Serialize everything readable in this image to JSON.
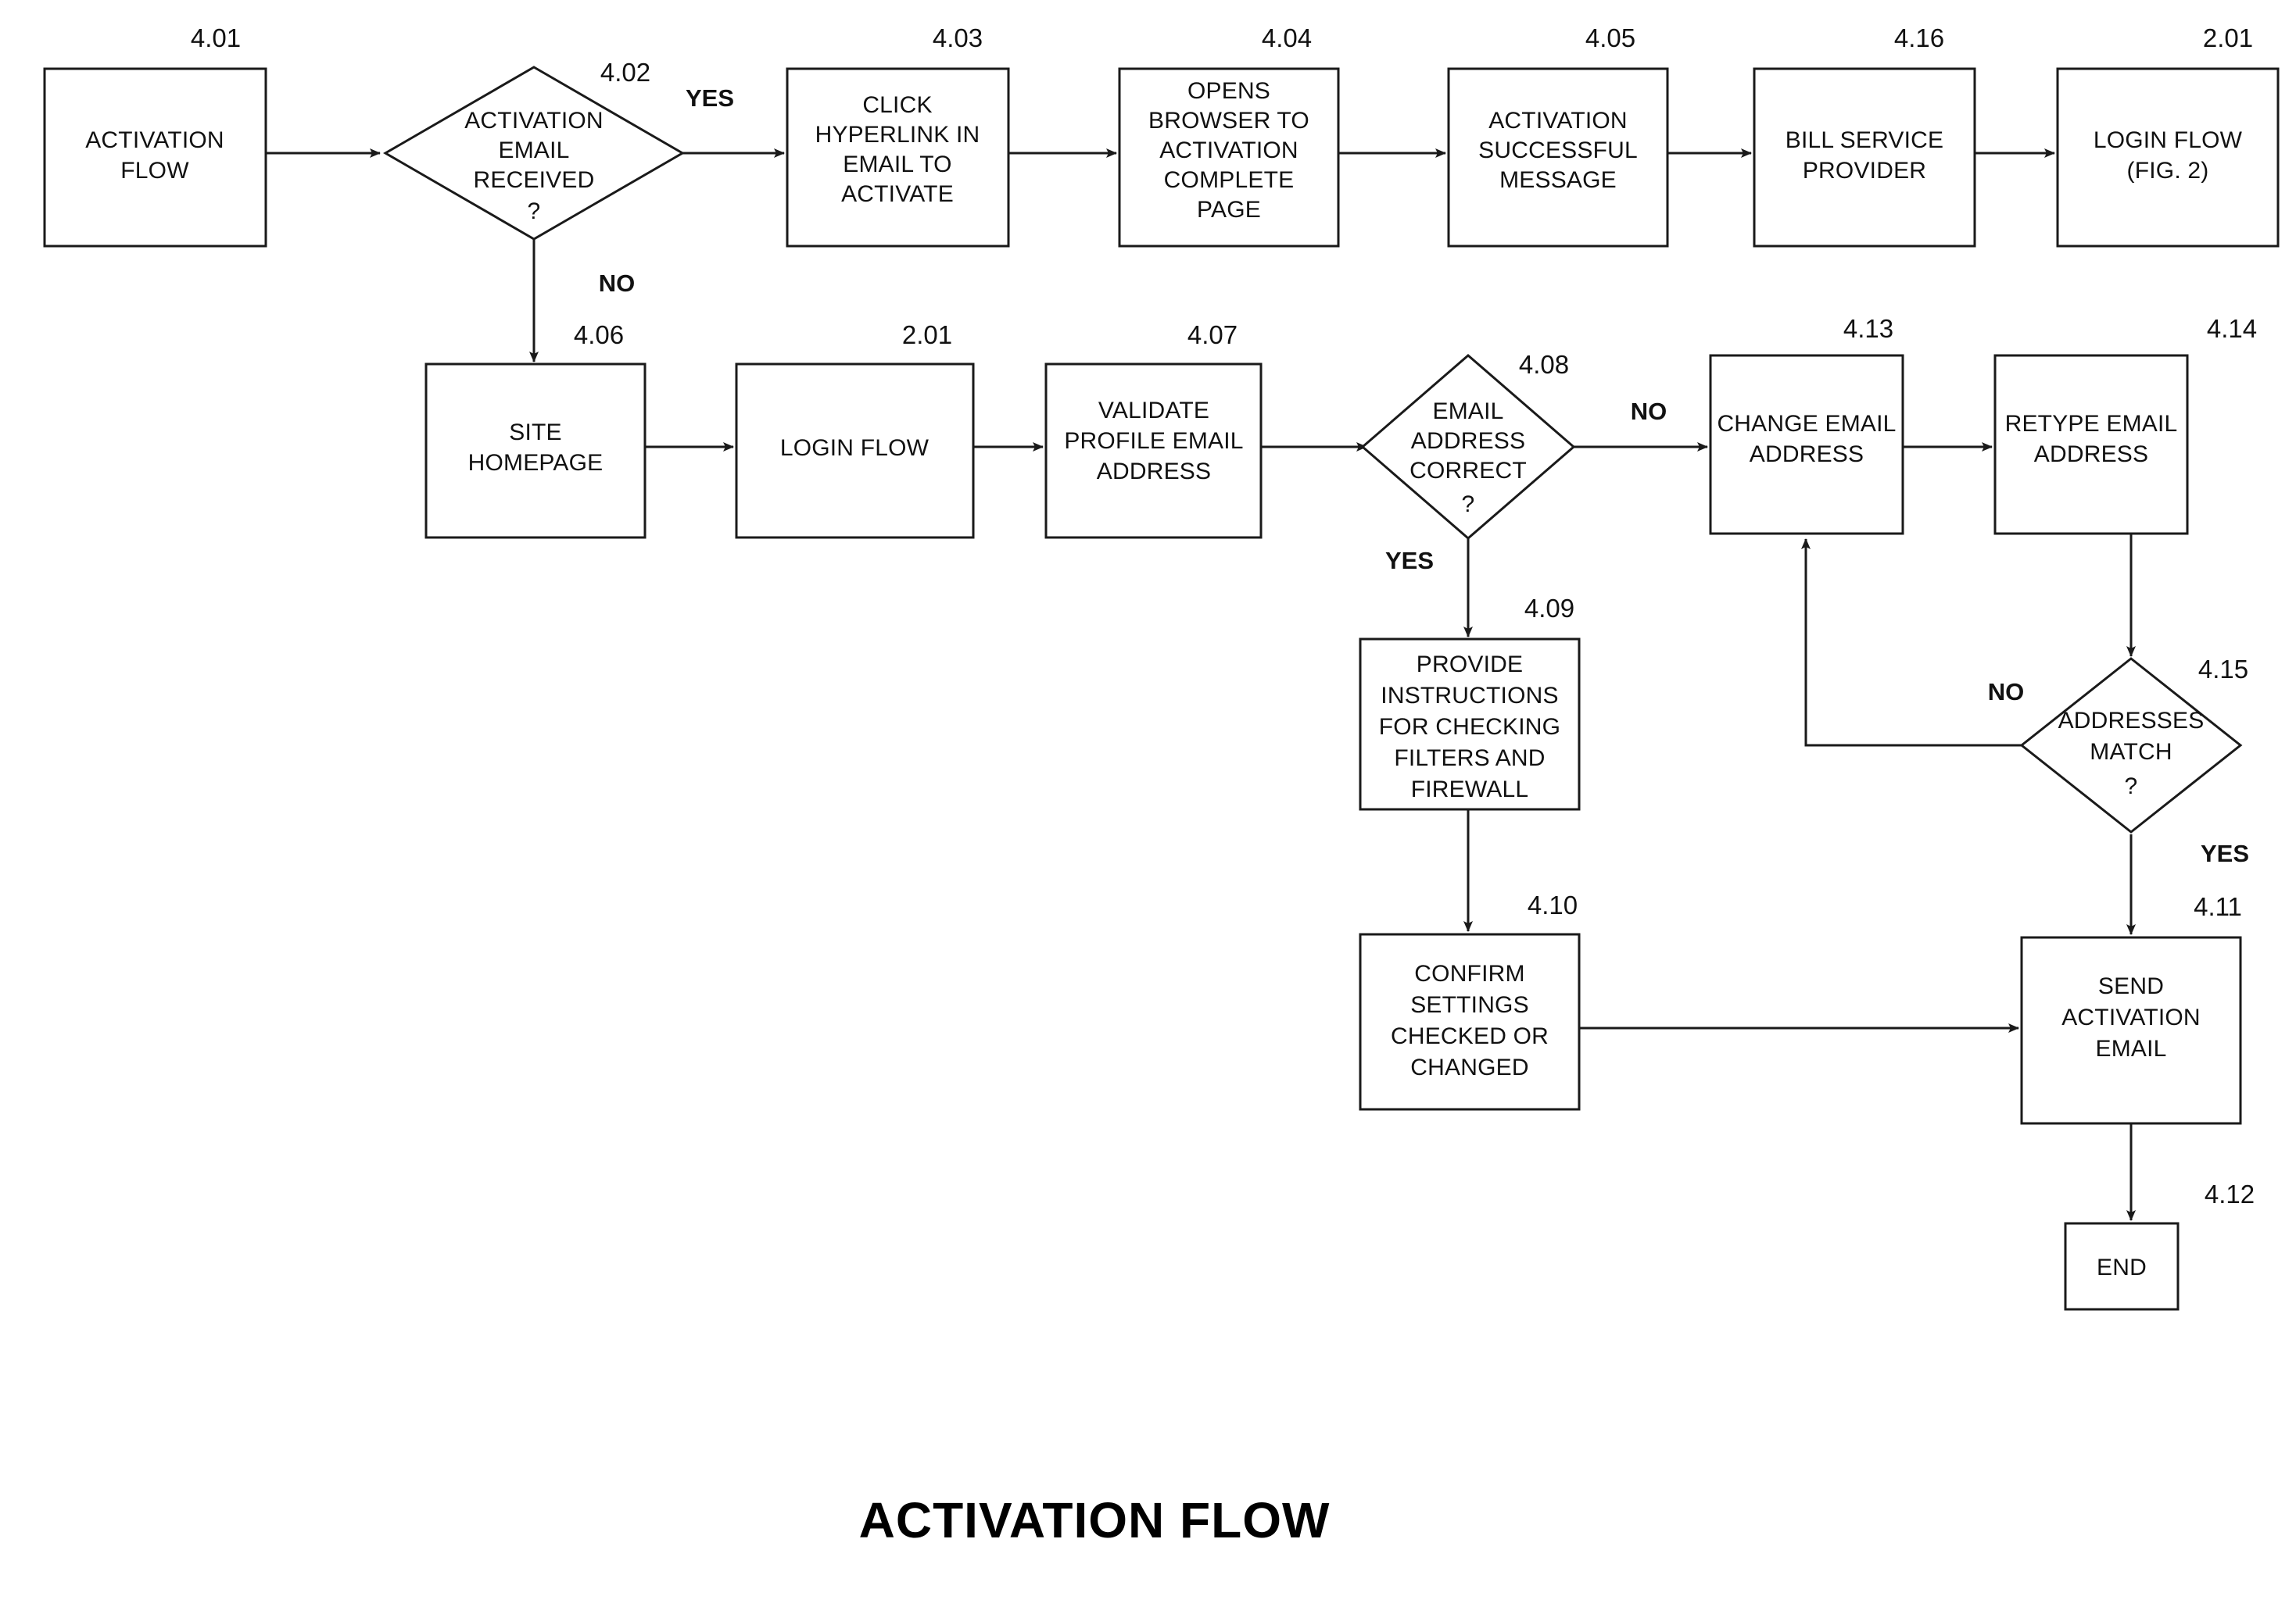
{
  "figure": {
    "title": "ACTIVATION FLOW"
  },
  "nodes": {
    "n401": {
      "ref": "4.01",
      "shape": "rect",
      "lines": [
        "ACTIVATION",
        "FLOW"
      ]
    },
    "n402": {
      "ref": "4.02",
      "shape": "diamond",
      "lines": [
        "ACTIVATION",
        "EMAIL",
        "RECEIVED",
        "?"
      ]
    },
    "n403": {
      "ref": "4.03",
      "shape": "rect",
      "lines": [
        "CLICK",
        "HYPERLINK IN",
        "EMAIL TO",
        "ACTIVATE"
      ]
    },
    "n404": {
      "ref": "4.04",
      "shape": "rect",
      "lines": [
        "OPENS",
        "BROWSER TO",
        "ACTIVATION",
        "COMPLETE",
        "PAGE"
      ]
    },
    "n405": {
      "ref": "4.05",
      "shape": "rect",
      "lines": [
        "ACTIVATION",
        "SUCCESSFUL",
        "MESSAGE"
      ]
    },
    "n416": {
      "ref": "4.16",
      "shape": "rect",
      "lines": [
        "BILL SERVICE",
        "PROVIDER"
      ]
    },
    "n201a": {
      "ref": "2.01",
      "shape": "rect",
      "lines": [
        "LOGIN FLOW",
        "(FIG. 2)"
      ]
    },
    "n406": {
      "ref": "4.06",
      "shape": "rect",
      "lines": [
        "SITE",
        "HOMEPAGE"
      ]
    },
    "n201b": {
      "ref": "2.01",
      "shape": "rect",
      "lines": [
        "LOGIN FLOW"
      ]
    },
    "n407": {
      "ref": "4.07",
      "shape": "rect",
      "lines": [
        "VALIDATE",
        "PROFILE EMAIL",
        "ADDRESS"
      ]
    },
    "n408": {
      "ref": "4.08",
      "shape": "diamond",
      "lines": [
        "EMAIL",
        "ADDRESS",
        "CORRECT",
        "?"
      ]
    },
    "n413": {
      "ref": "4.13",
      "shape": "rect",
      "lines": [
        "CHANGE EMAIL",
        "ADDRESS"
      ]
    },
    "n414": {
      "ref": "4.14",
      "shape": "rect",
      "lines": [
        "RETYPE EMAIL",
        "ADDRESS"
      ]
    },
    "n409": {
      "ref": "4.09",
      "shape": "rect",
      "lines": [
        "PROVIDE",
        "INSTRUCTIONS",
        "FOR CHECKING",
        "FILTERS AND",
        "FIREWALL"
      ]
    },
    "n410": {
      "ref": "4.10",
      "shape": "rect",
      "lines": [
        "CONFIRM",
        "SETTINGS",
        "CHECKED OR",
        "CHANGED"
      ]
    },
    "n415": {
      "ref": "4.15",
      "shape": "diamond",
      "lines": [
        "ADDRESSES",
        "MATCH",
        "?"
      ]
    },
    "n411": {
      "ref": "4.11",
      "shape": "rect",
      "lines": [
        "SEND",
        "ACTIVATION",
        "EMAIL"
      ]
    },
    "n412": {
      "ref": "4.12",
      "shape": "rect",
      "lines": [
        "END"
      ]
    }
  },
  "branch_labels": {
    "yes_402": "YES",
    "no_402": "NO",
    "no_408": "NO",
    "yes_408": "YES",
    "no_415": "NO",
    "yes_415": "YES"
  },
  "colors": {
    "stroke": "#1a1a1a",
    "text": "#111111",
    "background": "#ffffff"
  }
}
